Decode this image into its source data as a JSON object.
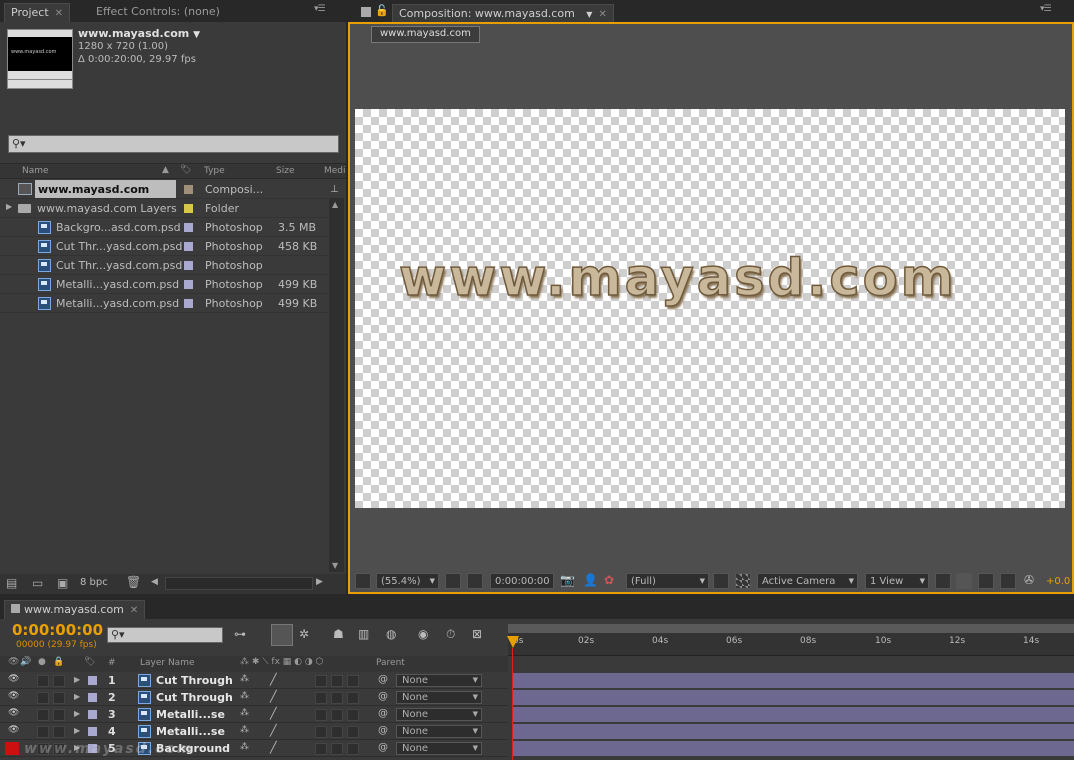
{
  "project_panel": {
    "tabs": [
      {
        "label": "Project",
        "active": true
      },
      {
        "label": "Effect Controls: (none)",
        "active": false
      }
    ],
    "thumbnail_text": "www.mayasd.com",
    "comp_name": "www.mayasd.com",
    "comp_dropdown": "▼",
    "comp_size": "1280 x 720 (1.00)",
    "comp_duration": "Δ 0:00:20:00, 29.97 fps",
    "search_glyph": "⚲▾",
    "columns": [
      "Name",
      "Type",
      "Size",
      "Medi"
    ],
    "items": [
      {
        "name": "www.mayasd.com",
        "type": "Composi...",
        "size": "",
        "color": "#a0907a",
        "kind": "comp",
        "selected": true
      },
      {
        "name": "www.mayasd.com Layers",
        "type": "Folder",
        "size": "",
        "color": "#d8c84a",
        "kind": "folder",
        "selected": false
      },
      {
        "name": "Backgro...asd.com.psd",
        "type": "Photoshop",
        "size": "3.5 MB",
        "color": "#a8a8d0",
        "kind": "psd",
        "selected": false
      },
      {
        "name": "Cut Thr...yasd.com.psd",
        "type": "Photoshop",
        "size": "458 KB",
        "color": "#a8a8d0",
        "kind": "psd",
        "selected": false
      },
      {
        "name": "Cut Thr...yasd.com.psd",
        "type": "Photoshop",
        "size": "",
        "color": "#a8a8d0",
        "kind": "psd",
        "selected": false
      },
      {
        "name": "Metalli...yasd.com.psd",
        "type": "Photoshop",
        "size": "499 KB",
        "color": "#a8a8d0",
        "kind": "psd",
        "selected": false
      },
      {
        "name": "Metalli...yasd.com.psd",
        "type": "Photoshop",
        "size": "499 KB",
        "color": "#a8a8d0",
        "kind": "psd",
        "selected": false
      }
    ],
    "bpc_label": "8 bpc"
  },
  "composition_panel": {
    "tab_label": "Composition: www.mayasd.com",
    "breadcrumb": "www.mayasd.com",
    "canvas_text": "www.mayasd.com",
    "zoom": "(55.4%)",
    "timecode": "0:00:00:00",
    "resolution": "(Full)",
    "camera": "Active Camera",
    "views": "1 View",
    "exposure": "+0.0"
  },
  "timeline_panel": {
    "tab_label": "www.mayasd.com",
    "current_time": "0:00:00:00",
    "frame_info": "00000 (29.97 fps)",
    "search_glyph": "⚲▾",
    "ruler_labels": [
      "0s",
      "02s",
      "04s",
      "06s",
      "08s",
      "10s",
      "12s",
      "14s"
    ],
    "columns": {
      "number": "#",
      "layer_name": "Layer Name",
      "parent": "Parent"
    },
    "layers": [
      {
        "num": "1",
        "name": "Cut Through",
        "parent": "None",
        "label_color": "#a8a8d0"
      },
      {
        "num": "2",
        "name": "Cut Through",
        "parent": "None",
        "label_color": "#a8a8d0"
      },
      {
        "num": "3",
        "name": "Metalli...se",
        "parent": "None",
        "label_color": "#a8a8d0"
      },
      {
        "num": "4",
        "name": "Metalli...se",
        "parent": "None",
        "label_color": "#a8a8d0"
      },
      {
        "num": "5",
        "name": "Background",
        "parent": "None",
        "label_color": "#a8a8d0"
      }
    ],
    "watermark": "www.mayasd.com"
  },
  "colors": {
    "accent_orange": "#e8a000",
    "panel_bg": "#3a3a3a",
    "layer_bar": "#6c6890"
  }
}
